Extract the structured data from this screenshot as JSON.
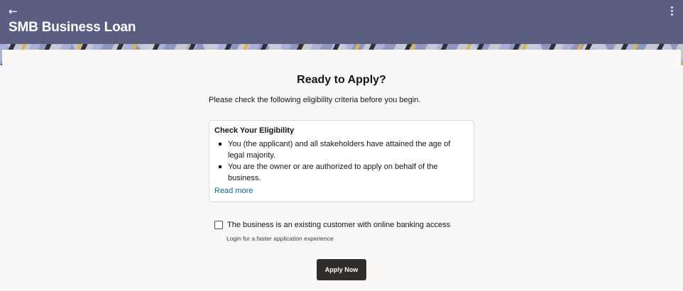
{
  "header": {
    "back_icon": "arrow-left-icon",
    "back_glyph": "←",
    "title": "SMB Business Loan",
    "menu_icon": "more-vertical-icon"
  },
  "main": {
    "heading": "Ready to Apply?",
    "intro": "Please check the following eligibility criteria before you begin.",
    "eligibility": {
      "title": "Check Your Eligibility",
      "items": [
        {
          "text": "You (the applicant) and all stakeholders have attained the age of legal majority."
        },
        {
          "text": "You are the owner or are authorized to apply on behalf of the business."
        }
      ],
      "read_more": "Read more"
    },
    "existing_customer": {
      "label": "The business is an existing customer with online banking access",
      "hint": "Login for a faster application experience",
      "checked": false
    },
    "apply_label": "Apply Now"
  },
  "colors": {
    "header_bg": "#5a5f82",
    "page_bg": "#f9f8f6",
    "link": "#0e6a8f",
    "primary_button": "#312d2a"
  }
}
